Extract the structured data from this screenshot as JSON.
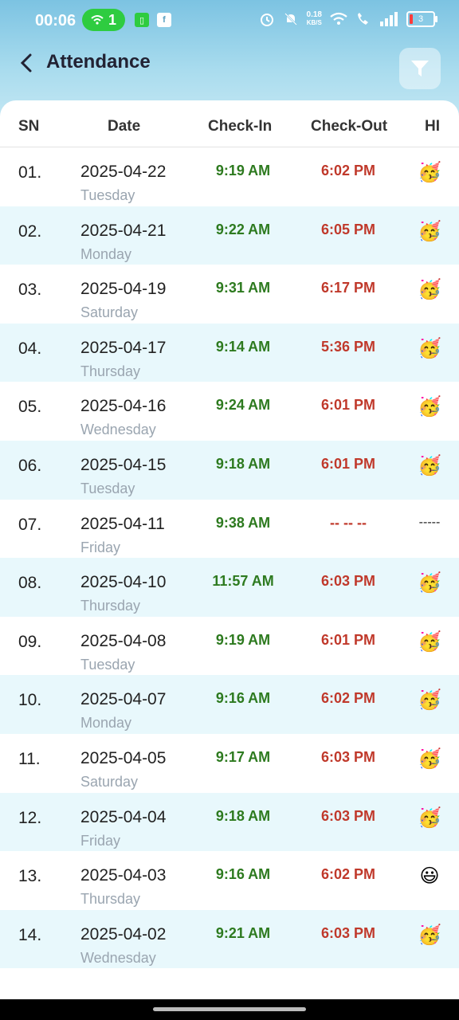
{
  "status_bar": {
    "time": "00:06",
    "wifi_badge": "1",
    "data_speed_value": "0.18",
    "data_speed_unit": "KB/S",
    "battery_level": "3"
  },
  "header": {
    "title": "Attendance"
  },
  "table": {
    "headers": {
      "sn": "SN",
      "date": "Date",
      "check_in": "Check-In",
      "check_out": "Check-Out",
      "hi": "HI"
    },
    "rows": [
      {
        "sn": "01.",
        "date": "2025-04-22",
        "day": "Tuesday",
        "check_in": "9:19 AM",
        "check_out": "6:02 PM",
        "hi": "🥳"
      },
      {
        "sn": "02.",
        "date": "2025-04-21",
        "day": "Monday",
        "check_in": "9:22 AM",
        "check_out": "6:05 PM",
        "hi": "🥳"
      },
      {
        "sn": "03.",
        "date": "2025-04-19",
        "day": "Saturday",
        "check_in": "9:31 AM",
        "check_out": "6:17 PM",
        "hi": "🥳"
      },
      {
        "sn": "04.",
        "date": "2025-04-17",
        "day": "Thursday",
        "check_in": "9:14 AM",
        "check_out": "5:36 PM",
        "hi": "🥳"
      },
      {
        "sn": "05.",
        "date": "2025-04-16",
        "day": "Wednesday",
        "check_in": "9:24 AM",
        "check_out": "6:01 PM",
        "hi": "🥳"
      },
      {
        "sn": "06.",
        "date": "2025-04-15",
        "day": "Tuesday",
        "check_in": "9:18 AM",
        "check_out": "6:01 PM",
        "hi": "🥳"
      },
      {
        "sn": "07.",
        "date": "2025-04-11",
        "day": "Friday",
        "check_in": "9:38 AM",
        "check_out": "-- -- --",
        "hi": "-----"
      },
      {
        "sn": "08.",
        "date": "2025-04-10",
        "day": "Thursday",
        "check_in": "11:57 AM",
        "check_out": "6:03 PM",
        "hi": "🥳"
      },
      {
        "sn": "09.",
        "date": "2025-04-08",
        "day": "Tuesday",
        "check_in": "9:19 AM",
        "check_out": "6:01 PM",
        "hi": "🥳"
      },
      {
        "sn": "10.",
        "date": "2025-04-07",
        "day": "Monday",
        "check_in": "9:16 AM",
        "check_out": "6:02 PM",
        "hi": "🥳"
      },
      {
        "sn": "11.",
        "date": "2025-04-05",
        "day": "Saturday",
        "check_in": "9:17 AM",
        "check_out": "6:03 PM",
        "hi": "🥳"
      },
      {
        "sn": "12.",
        "date": "2025-04-04",
        "day": "Friday",
        "check_in": "9:18 AM",
        "check_out": "6:03 PM",
        "hi": "🥳"
      },
      {
        "sn": "13.",
        "date": "2025-04-03",
        "day": "Thursday",
        "check_in": "9:16 AM",
        "check_out": "6:02 PM",
        "hi": "😃"
      },
      {
        "sn": "14.",
        "date": "2025-04-02",
        "day": "Wednesday",
        "check_in": "9:21 AM",
        "check_out": "6:03 PM",
        "hi": "🥳"
      }
    ]
  },
  "icons": {
    "back": "chevron-left-icon",
    "filter": "filter-funnel-icon",
    "party": "party-face-icon",
    "smile": "smiling-face-icon"
  },
  "colors": {
    "check_in": "#2d7a1f",
    "check_out": "#c0392b",
    "row_alt": "#e8f8fc",
    "header_gradient_top": "#7cc3e2"
  }
}
